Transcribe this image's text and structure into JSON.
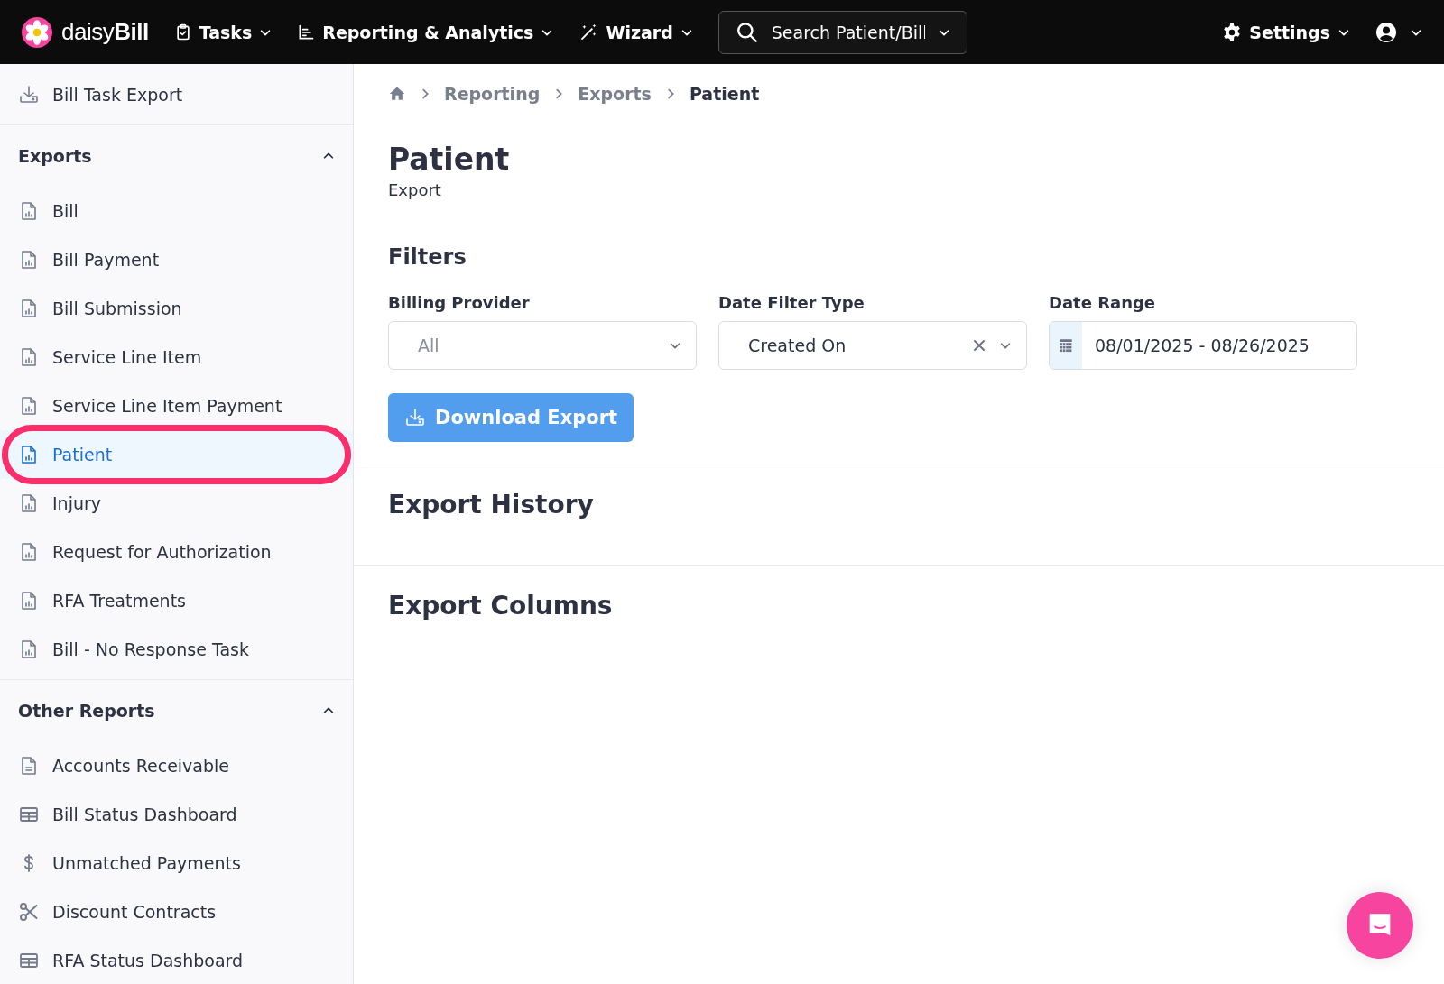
{
  "topbar": {
    "logo": "daisy**Bill**",
    "menus": [
      {
        "label": "Tasks",
        "kind": "clipboard"
      },
      {
        "label": "Reporting & Analytics",
        "kind": "chart"
      },
      {
        "label": "Wizard",
        "kind": "wand"
      }
    ],
    "search": {
      "placeholder": "Search Patient/Bill"
    },
    "settings": {
      "label": "Settings"
    }
  },
  "sidebar": {
    "top_item": {
      "label": "Bill Task Export",
      "kind": "download"
    },
    "sections": [
      {
        "title": "Exports",
        "expanded": true,
        "items": [
          {
            "label": "Bill",
            "kind": "report",
            "selected": false,
            "highlighted": false
          },
          {
            "label": "Bill Payment",
            "kind": "report",
            "selected": false,
            "highlighted": false
          },
          {
            "label": "Bill Submission",
            "kind": "report",
            "selected": false,
            "highlighted": false
          },
          {
            "label": "Service Line Item",
            "kind": "report",
            "selected": false,
            "highlighted": false
          },
          {
            "label": "Service Line Item Payment",
            "kind": "report",
            "selected": false,
            "highlighted": false
          },
          {
            "label": "Patient",
            "kind": "report",
            "selected": true,
            "highlighted": true
          },
          {
            "label": "Injury",
            "kind": "report",
            "selected": false,
            "highlighted": false
          },
          {
            "label": "Request for Authorization",
            "kind": "report",
            "selected": false,
            "highlighted": false
          },
          {
            "label": "RFA Treatments",
            "kind": "report",
            "selected": false,
            "highlighted": false
          },
          {
            "label": "Bill - No Response Task",
            "kind": "report",
            "selected": false,
            "highlighted": false
          }
        ]
      },
      {
        "title": "Other Reports",
        "expanded": true,
        "items": [
          {
            "label": "Accounts Receivable",
            "kind": "document",
            "selected": false,
            "highlighted": false
          },
          {
            "label": "Bill Status Dashboard",
            "kind": "table",
            "selected": false,
            "highlighted": false
          },
          {
            "label": "Unmatched Payments",
            "kind": "dollar",
            "selected": false,
            "highlighted": false
          },
          {
            "label": "Discount Contracts",
            "kind": "scissors",
            "selected": false,
            "highlighted": false
          },
          {
            "label": "RFA Status Dashboard",
            "kind": "table",
            "selected": false,
            "highlighted": false
          }
        ]
      }
    ]
  },
  "breadcrumb": [
    "Reporting",
    "Exports",
    "Patient"
  ],
  "page": {
    "title": "Patient",
    "subtitle": "Export"
  },
  "filters": {
    "title": "Filters",
    "fields": [
      {
        "kind": "select",
        "label": "Billing Provider",
        "placeholder": "All"
      },
      {
        "kind": "select",
        "label": "Date Filter Type",
        "value": "Created On",
        "clearable": true
      },
      {
        "kind": "daterange",
        "label": "Date Range",
        "value": "08/01/2025 - 08/26/2025"
      }
    ],
    "button": "Download Export"
  },
  "sections": [
    "Export History",
    "Export Columns"
  ]
}
